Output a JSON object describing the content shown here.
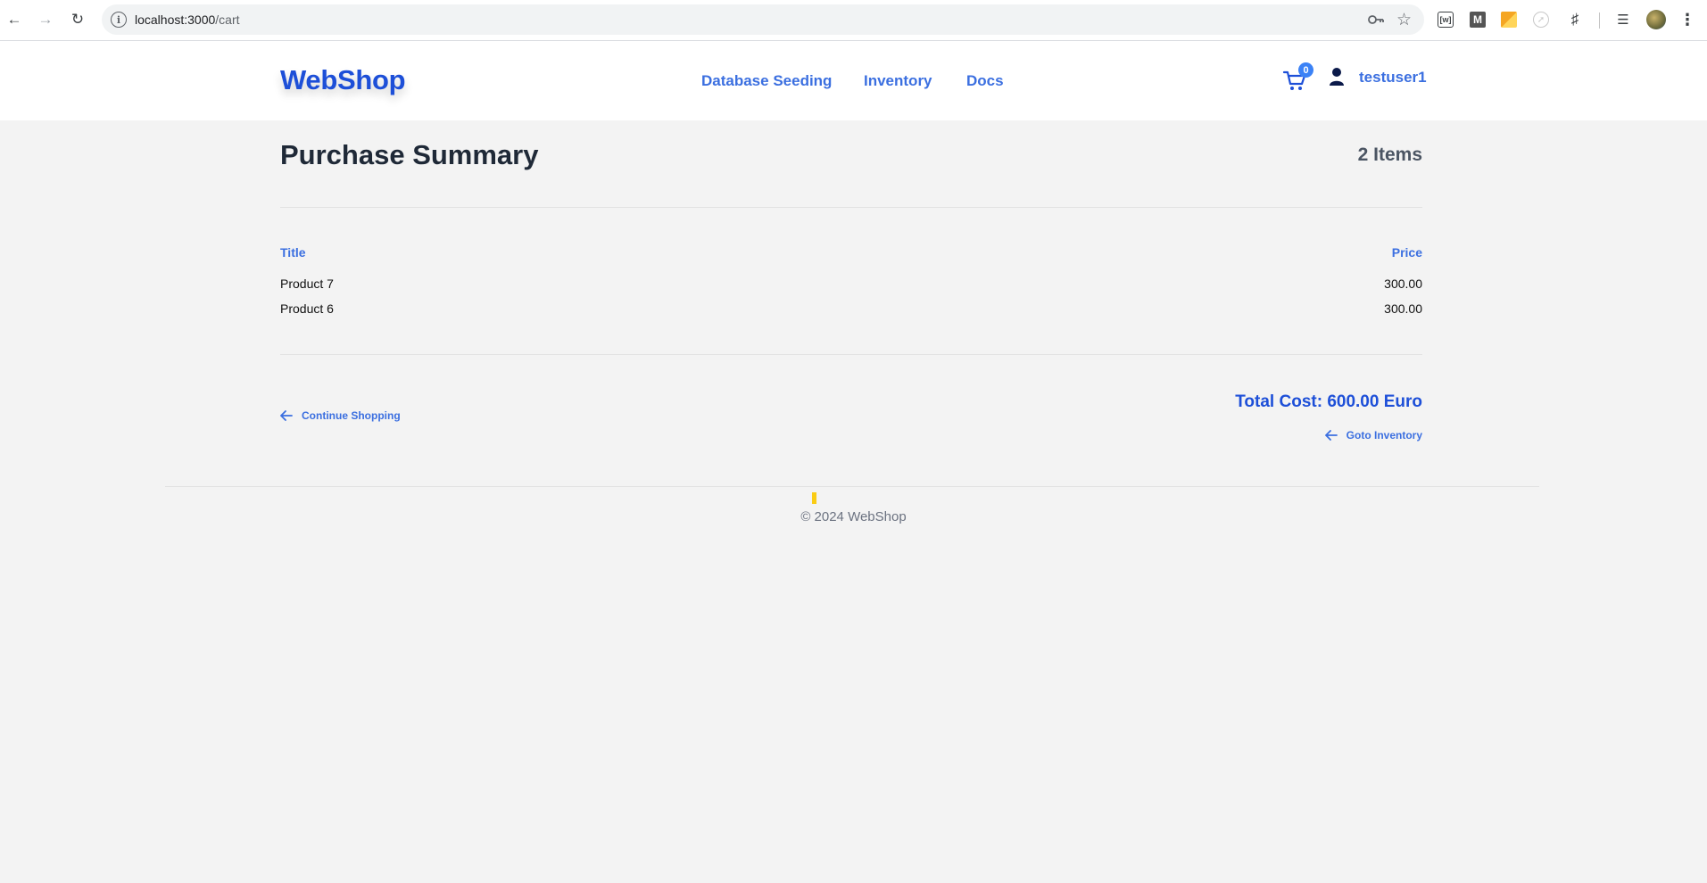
{
  "browser": {
    "url_host": "localhost:3000",
    "url_path": "/cart"
  },
  "header": {
    "brand": "WebShop",
    "nav": [
      "Database Seeding",
      "Inventory",
      "Docs"
    ],
    "cart_count": "0",
    "username": "testuser1"
  },
  "summary": {
    "title": "Purchase Summary",
    "item_count": "2 Items",
    "columns": {
      "title": "Title",
      "price": "Price"
    },
    "rows": [
      {
        "title": "Product 7",
        "price": "300.00"
      },
      {
        "title": "Product 6",
        "price": "300.00"
      }
    ],
    "continue_label": "Continue Shopping",
    "total": "Total Cost: 600.00 Euro",
    "goto_label": "Goto Inventory"
  },
  "footer": {
    "text": "© 2024 WebShop"
  },
  "colors": {
    "brand": "#1d4fd8",
    "link": "#3b6fe0",
    "badge": "#3b82f6",
    "page_bg": "#f3f3f3"
  }
}
